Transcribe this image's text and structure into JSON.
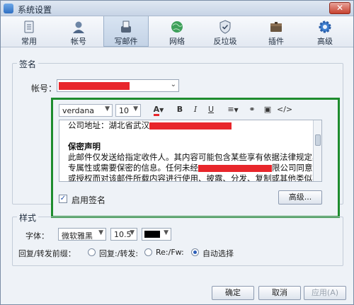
{
  "window": {
    "title": "系统设置",
    "close_label": "✕"
  },
  "tabs": [
    {
      "id": "general",
      "label": "常用"
    },
    {
      "id": "account",
      "label": "帐号"
    },
    {
      "id": "compose",
      "label": "写邮件"
    },
    {
      "id": "network",
      "label": "网络"
    },
    {
      "id": "antispam",
      "label": "反垃圾"
    },
    {
      "id": "plugins",
      "label": "插件"
    },
    {
      "id": "advanced",
      "label": "高级"
    }
  ],
  "active_tab": "写邮件",
  "signature": {
    "group_label": "签名",
    "account_label": "帐号：",
    "font_family": "verdana",
    "font_size": "10",
    "editor_lines": [
      {
        "text": "公司地址：湖北省武汉",
        "bold": false
      },
      {
        "text": "",
        "bold": false
      },
      {
        "text": "保密声明",
        "bold": true
      },
      {
        "text": "此邮件仅发送给指定收件人。其内容可能包含某些享有依据法律规定具有",
        "bold": false
      },
      {
        "text": "专属性或需要保密的信息。任何未经",
        "suffix": "限公司同意",
        "bold": false
      },
      {
        "text": "或授权而对该邮件所载内容进行使用、披露、分发、复制或其他类似不当",
        "bold": false
      }
    ],
    "enable_label": "启用签名",
    "enable_checked": true,
    "advanced_button": "高级..."
  },
  "style": {
    "group_label": "样式",
    "font_label": "字体：",
    "font_value": "微软雅黑",
    "size_value": "10.5",
    "color_value": "#000000",
    "prefix_label": "回复/转发前缀：",
    "options": [
      {
        "label": "回复:/转发:",
        "selected": false
      },
      {
        "label": "Re:/Fw:",
        "selected": false
      },
      {
        "label": "自动选择",
        "selected": true
      }
    ]
  },
  "buttons": {
    "ok": "确定",
    "cancel": "取消",
    "apply": "应用(A)"
  },
  "colors": {
    "accent": "#1e8c2e",
    "redaction": "#e8262b"
  }
}
